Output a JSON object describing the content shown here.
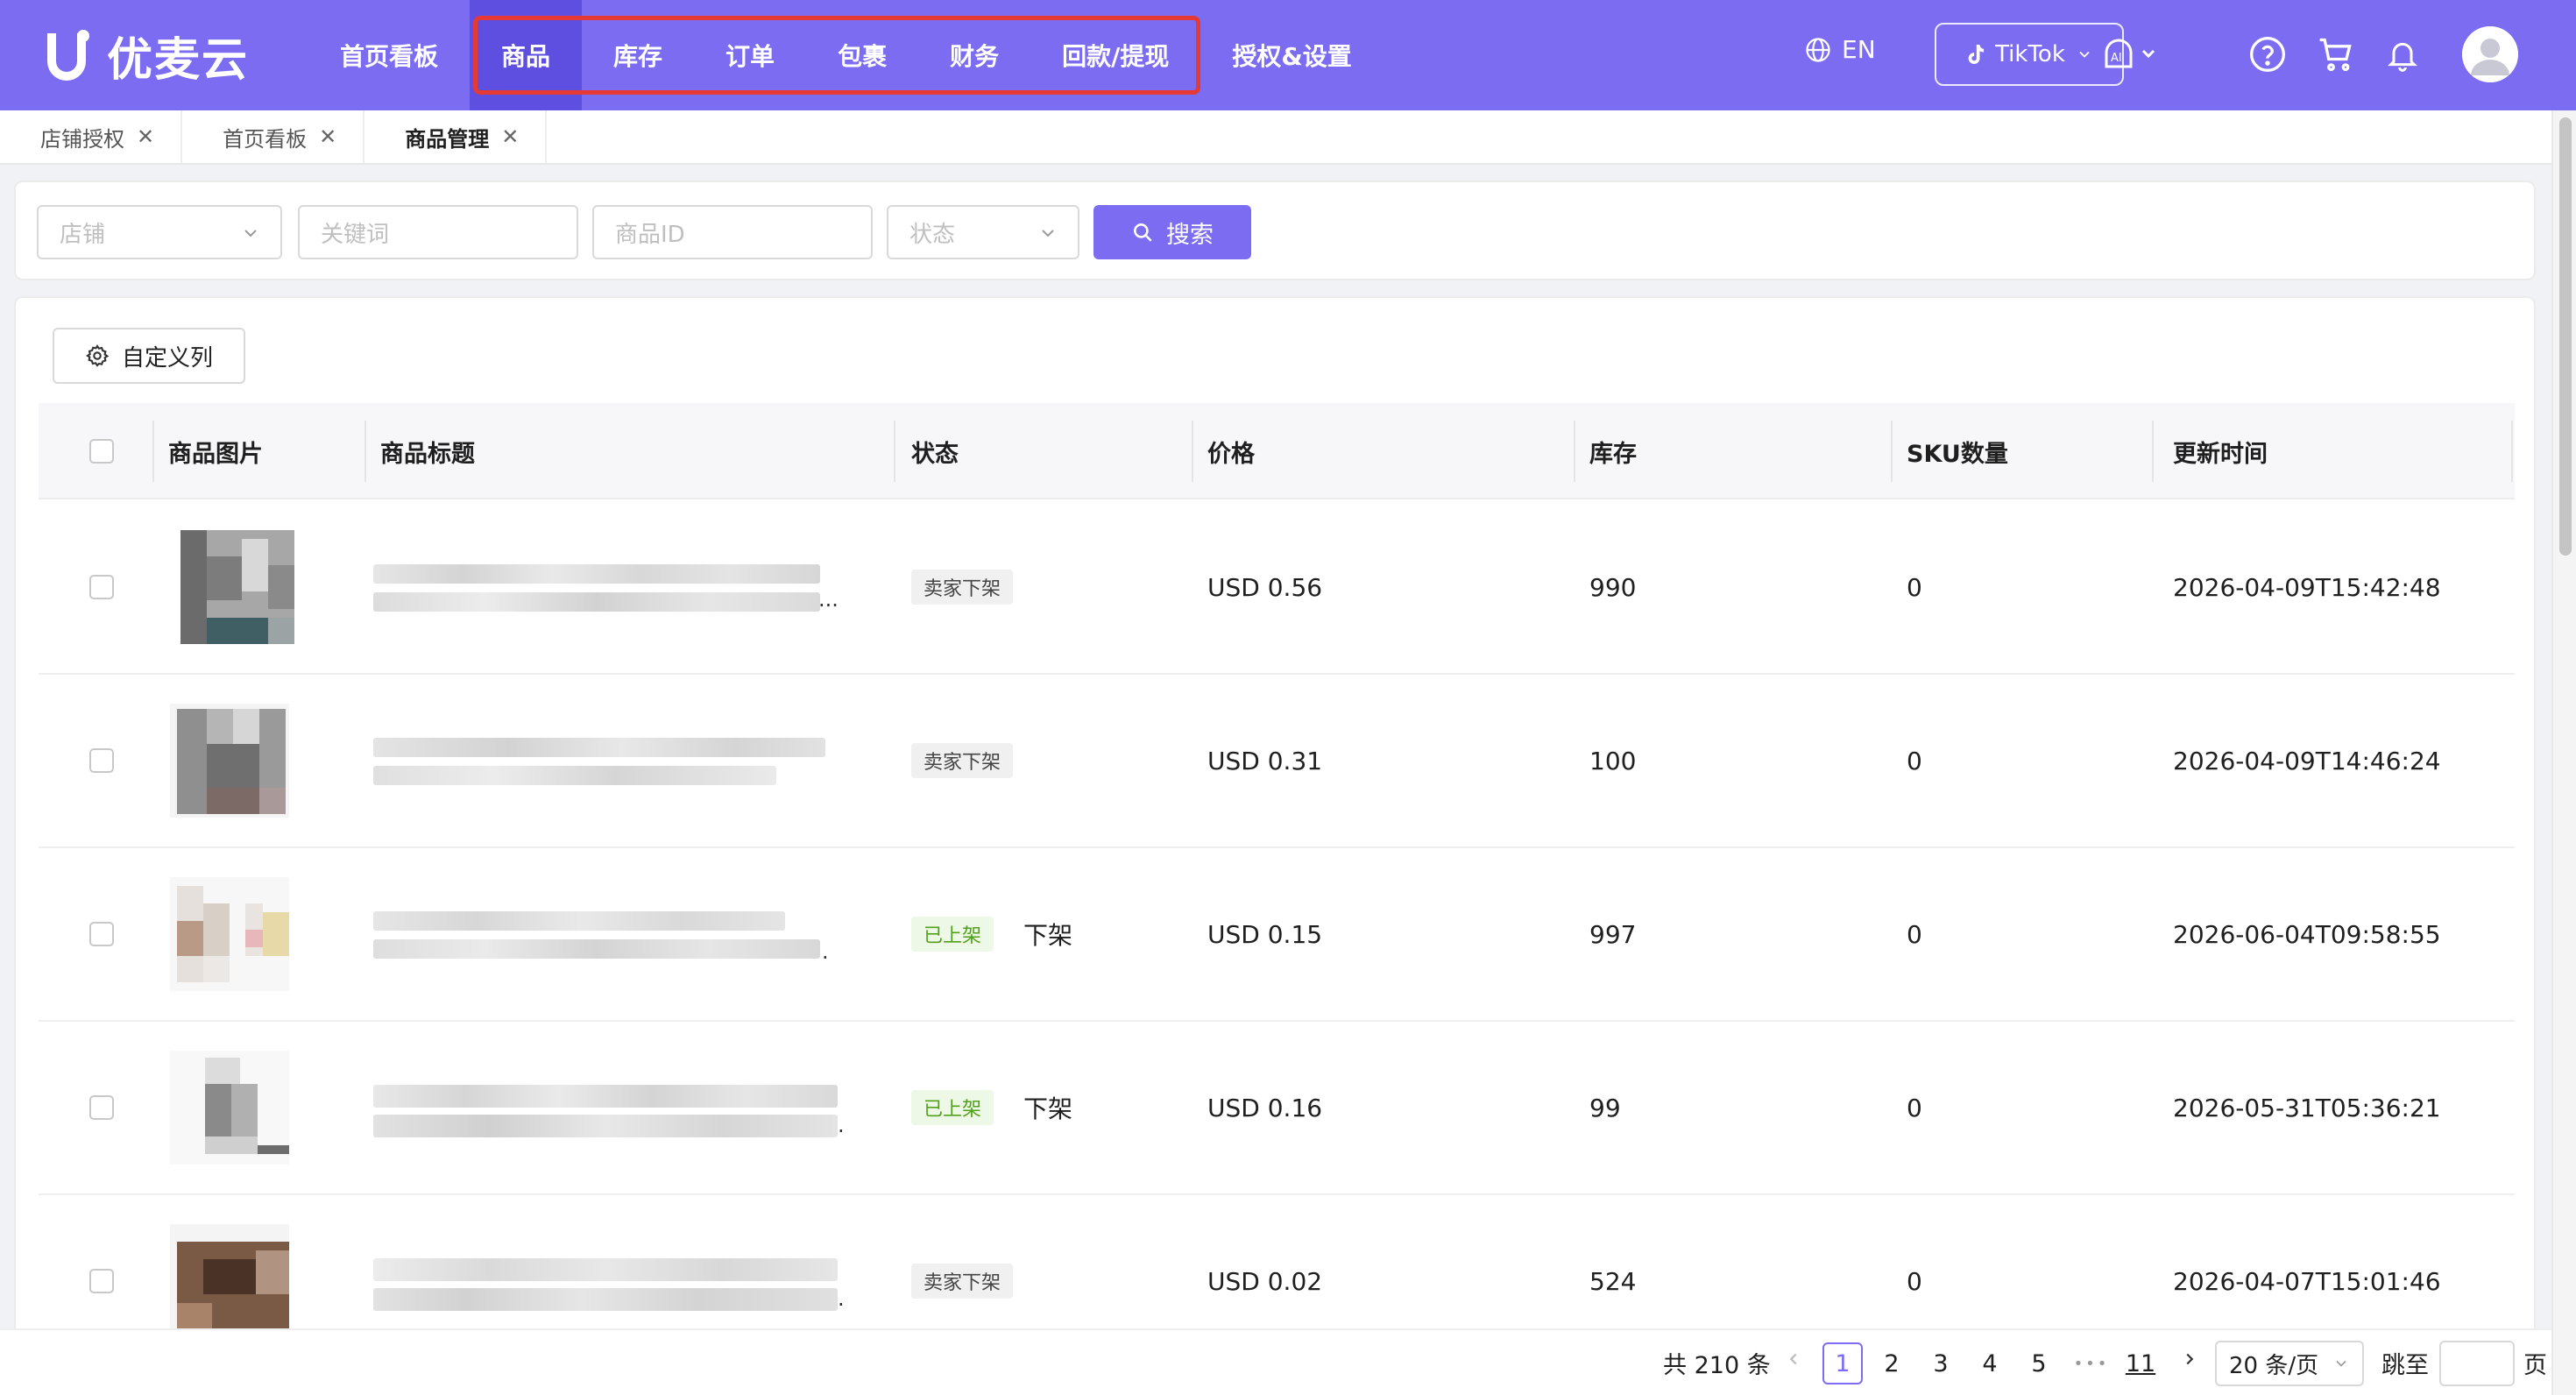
{
  "app": {
    "logo_text": "优麦云",
    "brand_color": "#7b6cf1"
  },
  "nav": {
    "items": [
      {
        "label": "首页看板"
      },
      {
        "label": "商品"
      },
      {
        "label": "库存"
      },
      {
        "label": "订单"
      },
      {
        "label": "包裹"
      },
      {
        "label": "财务"
      },
      {
        "label": "回款/提现"
      },
      {
        "label": "授权&设置"
      }
    ],
    "active": "商品",
    "language": "EN",
    "platform": "TikTok"
  },
  "tabs": [
    {
      "label": "店铺授权"
    },
    {
      "label": "首页看板"
    },
    {
      "label": "商品管理"
    }
  ],
  "filters": {
    "shop_placeholder": "店铺",
    "keyword_placeholder": "关键词",
    "product_id_placeholder": "商品ID",
    "status_placeholder": "状态",
    "search_label": "搜索"
  },
  "toolbar": {
    "custom_columns_label": "自定义列"
  },
  "table": {
    "headers": {
      "image": "商品图片",
      "title": "商品标题",
      "status": "状态",
      "price": "价格",
      "stock": "库存",
      "sku": "SKU数量",
      "updated": "更新时间"
    },
    "rows": [
      {
        "status": "卖家下架",
        "status_kind": "off",
        "action": "",
        "price": "USD 0.56",
        "stock": "990",
        "sku": "0",
        "updated": "2026-04-09T15:42:48",
        "title_ellipsis": "..."
      },
      {
        "status": "卖家下架",
        "status_kind": "off",
        "action": "",
        "price": "USD 0.31",
        "stock": "100",
        "sku": "0",
        "updated": "2026-04-09T14:46:24",
        "title_ellipsis": ""
      },
      {
        "status": "已上架",
        "status_kind": "on",
        "action": "下架",
        "price": "USD 0.15",
        "stock": "997",
        "sku": "0",
        "updated": "2026-06-04T09:58:55",
        "title_ellipsis": "."
      },
      {
        "status": "已上架",
        "status_kind": "on",
        "action": "下架",
        "price": "USD 0.16",
        "stock": "99",
        "sku": "0",
        "updated": "2026-05-31T05:36:21",
        "title_ellipsis": "."
      },
      {
        "status": "卖家下架",
        "status_kind": "off",
        "action": "",
        "price": "USD 0.02",
        "stock": "524",
        "sku": "0",
        "updated": "2026-04-07T15:01:46",
        "title_ellipsis": "."
      }
    ]
  },
  "pagination": {
    "total_text": "共 210 条",
    "pages": [
      "1",
      "2",
      "3",
      "4",
      "5"
    ],
    "ellipsis": "•••",
    "last_page": "11",
    "current_page": "1",
    "page_size": "20 条/页",
    "jump_label": "跳至",
    "page_suffix": "页"
  }
}
